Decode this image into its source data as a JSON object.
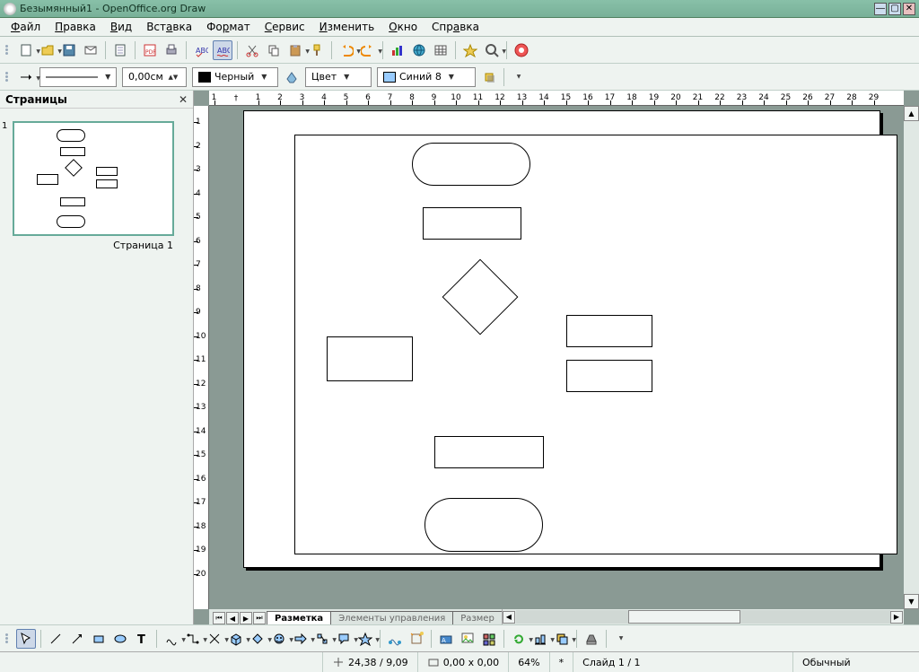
{
  "window": {
    "title": "Безымянный1 - OpenOffice.org Draw"
  },
  "menu": {
    "file": "Файл",
    "edit": "Правка",
    "view": "Вид",
    "insert": "Вставка",
    "format": "Формат",
    "tools": "Сервис",
    "modify": "Изменить",
    "window": "Окно",
    "help": "Справка"
  },
  "toolbar2": {
    "line_width": "0,00см",
    "line_color_label": "Черный",
    "fill_mode_label": "Цвет",
    "fill_color_label": "Синий 8",
    "line_color_hex": "#000000",
    "fill_color_hex": "#99ccff"
  },
  "side": {
    "header": "Страницы",
    "page_caption": "Страница 1",
    "page_num": "1"
  },
  "ruler": {
    "h": [
      "2",
      "1",
      "1",
      "2",
      "3",
      "4",
      "5",
      "6",
      "7",
      "8",
      "9",
      "10",
      "11",
      "12",
      "13",
      "14",
      "15",
      "16",
      "17",
      "18",
      "19",
      "20",
      "21",
      "22",
      "23",
      "24",
      "25",
      "26",
      "27",
      "28",
      "29"
    ],
    "v": [
      "1",
      "2",
      "3",
      "4",
      "5",
      "6",
      "7",
      "8",
      "9",
      "10",
      "11",
      "12",
      "13",
      "14",
      "15",
      "16",
      "17",
      "18",
      "19",
      "20"
    ]
  },
  "tabs": {
    "layout": "Разметка",
    "controls": "Элементы управления",
    "dim": "Размер"
  },
  "status": {
    "pos": "24,38 / 9,09",
    "size": "0,00 x 0,00",
    "zoom": "64%",
    "star": "*",
    "slide": "Слайд 1 / 1",
    "mode": "Обычный"
  }
}
